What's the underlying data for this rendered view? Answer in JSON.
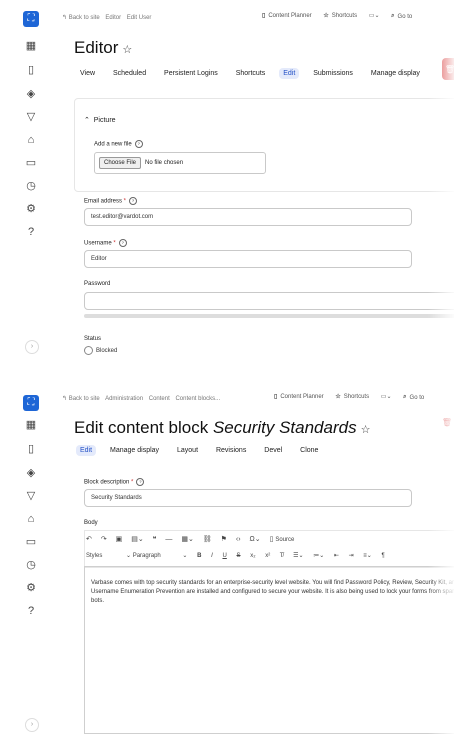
{
  "rail_icons": [
    "logo-icon",
    "grid-icon",
    "file-icon",
    "layers-icon",
    "filter-icon",
    "bag-icon",
    "book-icon",
    "clock-icon",
    "settings-icon",
    "help-icon"
  ],
  "accent": "#1e66d6",
  "danger": "#d94444",
  "panel1": {
    "breadcrumbs": [
      "↰ Back to site",
      "Editor",
      "Edit User"
    ],
    "tools": {
      "content_planner": "Content Planner",
      "shortcuts": "Shortcuts",
      "search": "Go to"
    },
    "title": "Editor",
    "tabs": [
      "View",
      "Scheduled",
      "Persistent Logins",
      "Shortcuts",
      "Edit",
      "Submissions",
      "Manage display"
    ],
    "active_tab": "Edit",
    "picture_section": "Picture",
    "add_file_label": "Add a new file",
    "choose_file": "Choose File",
    "no_file": "No file chosen",
    "email_label": "Email address",
    "email_value": "test.editor@vardot.com",
    "username_label": "Username",
    "username_value": "Editor",
    "password_label": "Password",
    "status_label": "Status",
    "status_option": "Blocked"
  },
  "panel2": {
    "breadcrumbs": [
      "↰ Back to site",
      "Administration",
      "Content",
      "Content blocks..."
    ],
    "tools": {
      "content_planner": "Content Planner",
      "shortcuts": "Shortcuts",
      "search": "Go to"
    },
    "title_prefix": "Edit content block",
    "title_entity": "Security Standards",
    "tabs": [
      "Edit",
      "Manage display",
      "Layout",
      "Revisions",
      "Devel",
      "Clone"
    ],
    "active_tab": "Edit",
    "block_desc_label": "Block description",
    "block_desc_value": "Security Standards",
    "body_label": "Body",
    "source_label": "Source",
    "styles_label": "Styles",
    "paragraph_label": "Paragraph",
    "body_text": "Varbase comes with top security standards for an enterprise-security level website. You will find Password Policy, Review, Security Kit, and Username Enumeration Prevention are installed and configured to secure your website. It is also being used to lock your forms from spam bots."
  }
}
